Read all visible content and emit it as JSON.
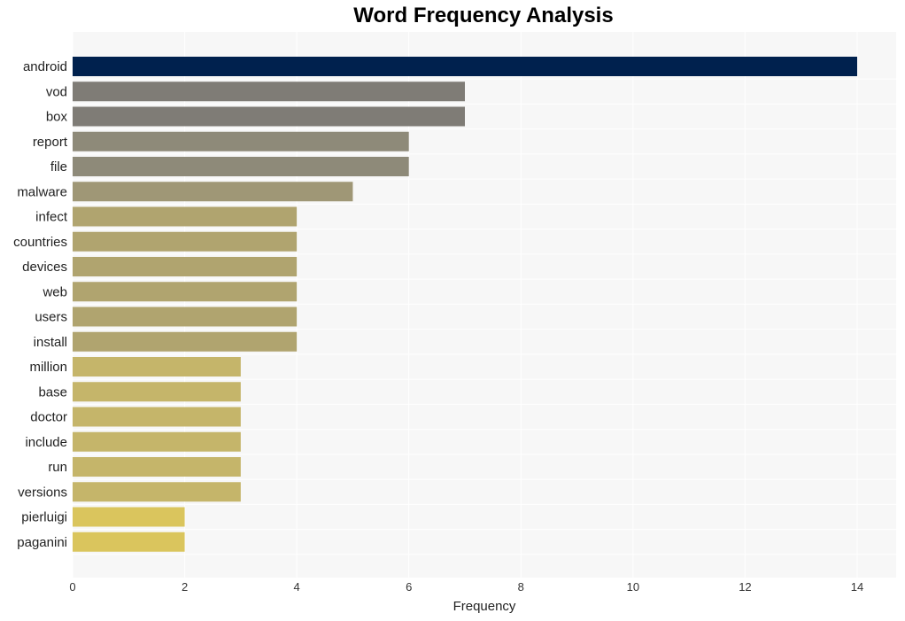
{
  "chart_data": {
    "type": "bar",
    "orientation": "horizontal",
    "title": "Word Frequency Analysis",
    "xlabel": "Frequency",
    "ylabel": "",
    "xlim": [
      0,
      14.7
    ],
    "xticks": [
      0,
      2,
      4,
      6,
      8,
      10,
      12,
      14
    ],
    "grid": true,
    "categories": [
      "android",
      "vod",
      "box",
      "report",
      "file",
      "malware",
      "infect",
      "countries",
      "devices",
      "web",
      "users",
      "install",
      "million",
      "base",
      "doctor",
      "include",
      "run",
      "versions",
      "pierluigi",
      "paganini"
    ],
    "values": [
      14,
      7,
      7,
      6,
      6,
      5,
      4,
      4,
      4,
      4,
      4,
      4,
      3,
      3,
      3,
      3,
      3,
      3,
      2,
      2
    ],
    "colors": [
      "#00214e",
      "#7f7c76",
      "#7f7c76",
      "#8e8a79",
      "#8e8a79",
      "#9f9776",
      "#b0a46f",
      "#b0a46f",
      "#b0a46f",
      "#b0a46f",
      "#b0a46f",
      "#b0a46f",
      "#c5b56a",
      "#c5b56a",
      "#c5b56a",
      "#c5b56a",
      "#c5b56a",
      "#c5b56a",
      "#dac55d",
      "#dac55d"
    ]
  }
}
